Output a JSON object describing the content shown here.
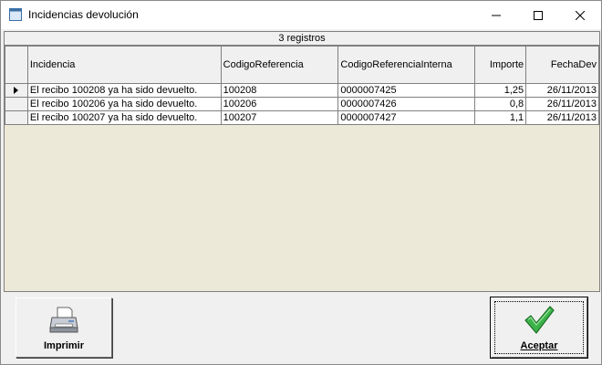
{
  "window": {
    "title": "Incidencias devolución",
    "icon": "window-app-icon"
  },
  "grid": {
    "record_count_label": "3 registros",
    "columns": [
      "Incidencia",
      "CodigoReferencia",
      "CodigoReferenciaInterna",
      "Importe",
      "FechaDev"
    ],
    "rows": [
      {
        "incidencia": "El recibo 100208 ya ha sido devuelto.",
        "codigo": "100208",
        "interna": "0000007425",
        "importe": "1,25",
        "fecha": "26/11/2013"
      },
      {
        "incidencia": "El recibo 100206 ya ha sido devuelto.",
        "codigo": "100206",
        "interna": "0000007426",
        "importe": "0,8",
        "fecha": "26/11/2013"
      },
      {
        "incidencia": "El recibo 100207 ya ha sido devuelto.",
        "codigo": "100207",
        "interna": "0000007427",
        "importe": "1,1",
        "fecha": "26/11/2013"
      }
    ]
  },
  "buttons": {
    "print": {
      "label": "Imprimir",
      "icon": "printer-icon"
    },
    "accept": {
      "label": "Aceptar",
      "icon": "checkmark-icon",
      "accent": "#2e8b2e"
    }
  }
}
